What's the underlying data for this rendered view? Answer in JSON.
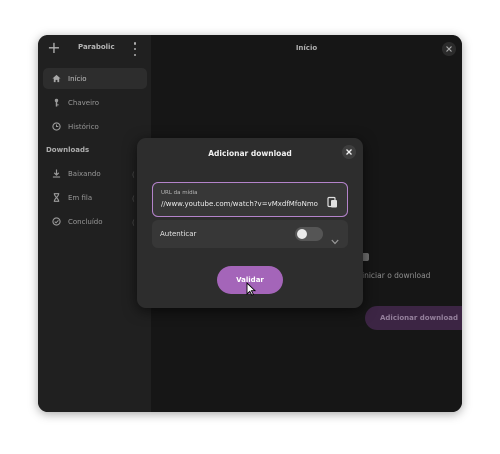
{
  "app": {
    "title": "Parabolic"
  },
  "sidebar": {
    "items": [
      {
        "label": "Início",
        "icon": "home-icon",
        "active": true
      },
      {
        "label": "Chaveiro",
        "icon": "key-icon",
        "active": false
      },
      {
        "label": "Histórico",
        "icon": "history-icon",
        "active": false
      }
    ],
    "downloads_section": "Downloads",
    "download_items": [
      {
        "label": "Baixando",
        "icon": "download-icon"
      },
      {
        "label": "Em fila",
        "icon": "hourglass-icon"
      },
      {
        "label": "Concluído",
        "icon": "check-circle-icon"
      }
    ]
  },
  "main": {
    "title": "Início",
    "hint_text": "iniciar o download",
    "add_download_label": "Adicionar download"
  },
  "dialog": {
    "title": "Adicionar download",
    "url_label": "URL da mídia",
    "url_value": "//www.youtube.com/watch?v=vMxdfMfoNmo",
    "auth_label": "Autenticar",
    "auth_enabled": false,
    "validate_label": "Validar"
  },
  "colors": {
    "accent": "#a465b9",
    "accent_dim": "#50325b",
    "focus_border": "#b483cb",
    "sidebar_bg": "#2b2b2b",
    "content_bg": "#1e1e1e"
  }
}
